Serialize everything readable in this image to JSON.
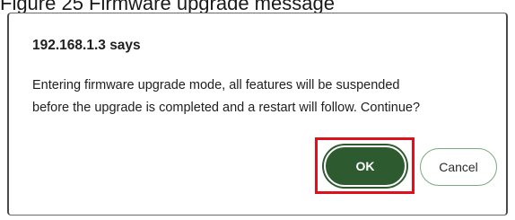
{
  "caption": {
    "text": "Figure 25   Firmware upgrade message"
  },
  "dialog": {
    "title": "192.168.1.3 says",
    "message_lines": [
      "Entering firmware upgrade mode, all features will be suspended",
      "before the upgrade is completed and a restart will follow. Continue?"
    ],
    "ok_label": "OK",
    "cancel_label": "Cancel"
  },
  "colors": {
    "ok_background": "#2d5a2f",
    "highlight": "#e0101a",
    "cancel_border": "#7da882"
  }
}
